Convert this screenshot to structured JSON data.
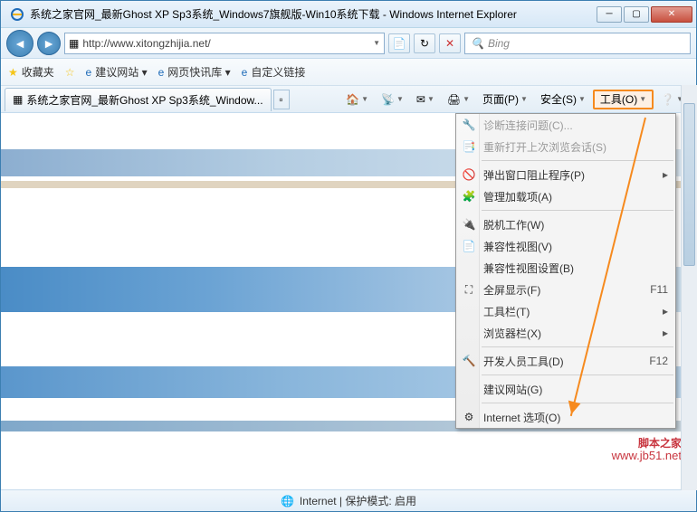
{
  "window": {
    "title": "系统之家官网_最新Ghost XP Sp3系统_Windows7旗舰版-Win10系统下载 - Windows Internet Explorer"
  },
  "address": {
    "url": "http://www.xitongzhijia.net/"
  },
  "search": {
    "placeholder": "Bing"
  },
  "favorites": {
    "label": "收藏夹",
    "links": [
      {
        "label": "建议网站 ▾"
      },
      {
        "label": "网页快讯库 ▾"
      },
      {
        "label": "自定义链接"
      }
    ]
  },
  "tab": {
    "title": "系统之家官网_最新Ghost XP Sp3系统_Window..."
  },
  "cmdbar": {
    "page": "页面(P)",
    "safety": "安全(S)",
    "tools": "工具(O)"
  },
  "menu": {
    "diagnose": "诊断连接问题(C)...",
    "reopen": "重新打开上次浏览会话(S)",
    "popup": "弹出窗口阻止程序(P)",
    "addons": "管理加载项(A)",
    "offline": "脱机工作(W)",
    "compat": "兼容性视图(V)",
    "compatset": "兼容性视图设置(B)",
    "fullscreen": "全屏显示(F)",
    "fullscreen_key": "F11",
    "toolbars": "工具栏(T)",
    "explorerbar": "浏览器栏(X)",
    "devtools": "开发人员工具(D)",
    "devtools_key": "F12",
    "suggest": "建议网站(G)",
    "options": "Internet 选项(O)"
  },
  "status": {
    "text": "Internet | 保护模式: 启用"
  },
  "watermark": {
    "name": "脚本之家",
    "url": "www.jb51.net"
  }
}
